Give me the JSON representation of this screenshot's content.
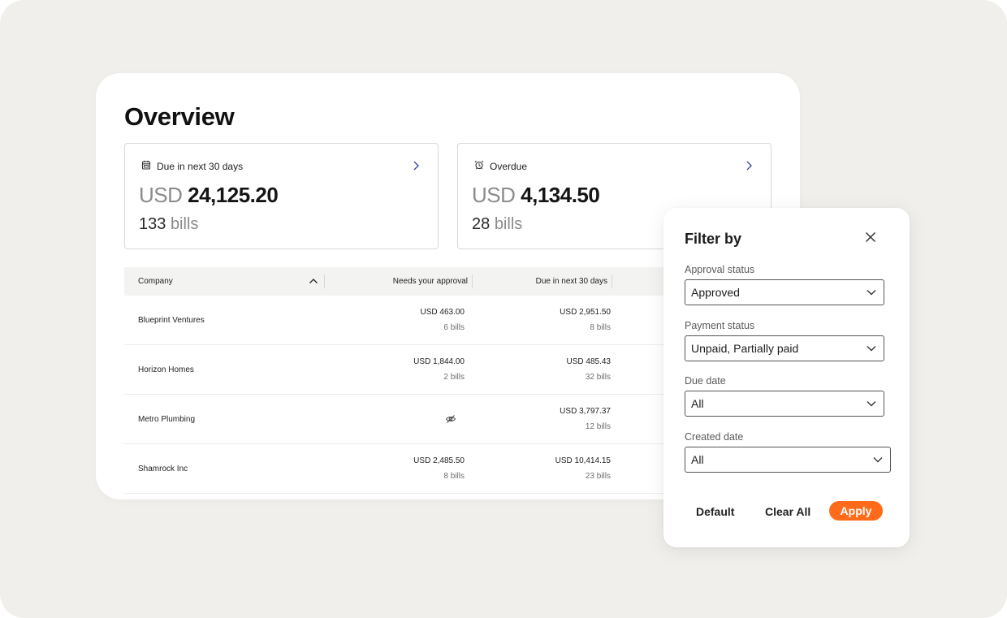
{
  "page": {
    "title": "Overview"
  },
  "summary_cards": [
    {
      "label": "Due in next 30 days",
      "currency": "USD",
      "amount": "24,125.20",
      "bill_count": "133",
      "bill_unit": "bills",
      "icon": "calendar-icon"
    },
    {
      "label": "Overdue",
      "currency": "USD",
      "amount": "4,134.50",
      "bill_count": "28",
      "bill_unit": "bills",
      "icon": "alarm-clock-icon"
    }
  ],
  "table": {
    "columns": [
      "Company",
      "Needs your approval",
      "Due in next 30 days"
    ],
    "rows": [
      {
        "company": "Blueprint Ventures",
        "approval_amount": "USD 463.00",
        "approval_bills": "6 bills",
        "due_amount": "USD 2,951.50",
        "due_bills": "8 bills"
      },
      {
        "company": "Horizon Homes",
        "approval_amount": "USD 1,844.00",
        "approval_bills": "2 bills",
        "due_amount": "USD 485.43",
        "due_bills": "32 bills"
      },
      {
        "company": "Metro Plumbing",
        "approval_amount": "",
        "approval_bills": "",
        "due_amount": "USD 3,797.37",
        "due_bills": "12 bills"
      },
      {
        "company": "Shamrock Inc",
        "approval_amount": "USD 2,485.50",
        "approval_bills": "8 bills",
        "due_amount": "USD 10,414.15",
        "due_bills": "23 bills"
      }
    ]
  },
  "filter": {
    "title": "Filter by",
    "groups": [
      {
        "label": "Approval status",
        "value": "Approved"
      },
      {
        "label": "Payment status",
        "value": "Unpaid, Partially paid"
      },
      {
        "label": "Due date",
        "value": "All"
      },
      {
        "label": "Created date",
        "value": "All"
      }
    ],
    "buttons": {
      "default": "Default",
      "clear_all": "Clear All",
      "apply": "Apply"
    }
  },
  "colors": {
    "accent": "#ff6b1a",
    "background": "#f0efeb",
    "link_chevron": "#3b4a9e"
  }
}
